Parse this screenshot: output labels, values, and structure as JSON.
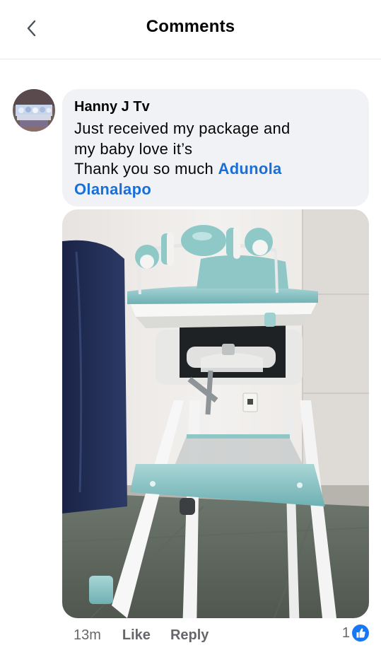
{
  "header": {
    "title": "Comments"
  },
  "comment": {
    "author": "Hanny J Tv",
    "text_lines": [
      "Just received my package and",
      "my baby love it’s",
      "Thank you so much "
    ],
    "mention": {
      "first": "Adunola",
      "last": "Olanalapo"
    },
    "time": "13m",
    "like_label": "Like",
    "reply_label": "Reply",
    "reaction_count": "1",
    "reaction_color": "#1877f2"
  },
  "icons": {
    "back": "chevron-left-icon",
    "reaction": "like-thumb-icon"
  }
}
